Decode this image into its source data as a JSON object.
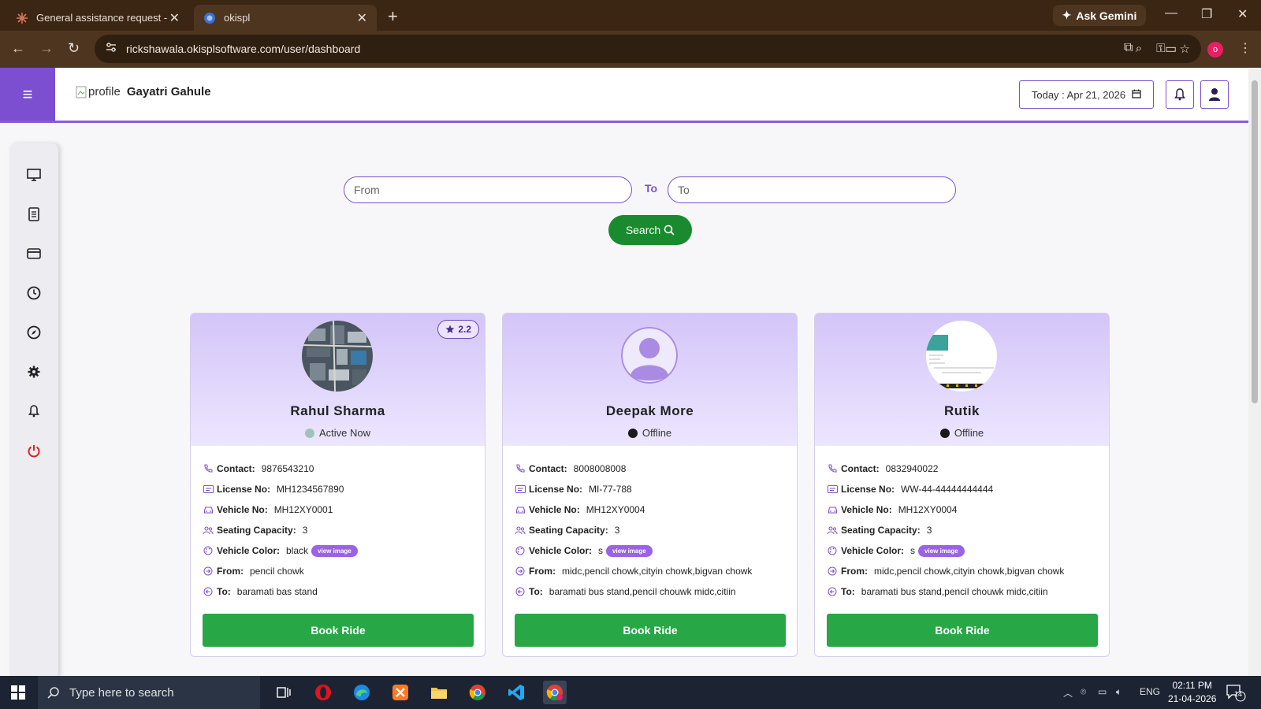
{
  "browser": {
    "tabs": [
      {
        "title": "General assistance request - Cla",
        "active": false
      },
      {
        "title": "okispl",
        "active": true
      }
    ],
    "url": "rickshawala.okisplsoftware.com/user/dashboard",
    "gemini_label": "Ask Gemini",
    "profile_initial": "o"
  },
  "header": {
    "profile_alt": "profile",
    "user_name": "Gayatri Gahule",
    "date_label": "Today : Apr 21, 2026"
  },
  "sidebar": {
    "items": [
      "monitor-icon",
      "document-icon",
      "card-icon",
      "clock-icon",
      "compass-icon",
      "gear-icon",
      "bell-icon",
      "power-icon"
    ]
  },
  "search": {
    "from_placeholder": "From",
    "to_label": "To",
    "to_placeholder": "To",
    "button_label": "Search"
  },
  "labels": {
    "contact": "Contact:",
    "license": "License No:",
    "vehicle": "Vehicle No:",
    "seating": "Seating Capacity:",
    "color": "Vehicle Color:",
    "from": "From:",
    "to": "To:",
    "view_image": "view image",
    "book": "Book Ride"
  },
  "drivers": [
    {
      "name": "Rahul Sharma",
      "rating": "2.2",
      "status": "Active Now",
      "status_color": "#9fc4b5",
      "contact": "9876543210",
      "license": "MH1234567890",
      "vehicle": "MH12XY0001",
      "seating": "3",
      "color": "black",
      "from": "pencil chowk",
      "to": "baramati bas stand"
    },
    {
      "name": "Deepak More",
      "status": "Offline",
      "status_color": "#1a1a1a",
      "contact": "8008008008",
      "license": "MI-77-788",
      "vehicle": "MH12XY0004",
      "seating": "3",
      "color": "s",
      "from": "midc,pencil chowk,cityin chowk,bigvan chowk",
      "to": "baramati bus stand,pencil chouwk midc,citiin"
    },
    {
      "name": "Rutik",
      "status": "Offline",
      "status_color": "#1a1a1a",
      "contact": "0832940022",
      "license": "WW-44-44444444444",
      "vehicle": "MH12XY0004",
      "seating": "3",
      "color": "s",
      "from": "midc,pencil chowk,cityin chowk,bigvan chowk",
      "to": "baramati bus stand,pencil chouwk midc,citiin"
    }
  ],
  "taskbar": {
    "search_placeholder": "Type here to search",
    "language": "ENG",
    "time": "02:11 PM",
    "date": "21-04-2026",
    "notification_count": "14"
  },
  "colors": {
    "accent": "#7b4fd0",
    "book_button": "#27a745",
    "search_button": "#1a8a2e"
  }
}
